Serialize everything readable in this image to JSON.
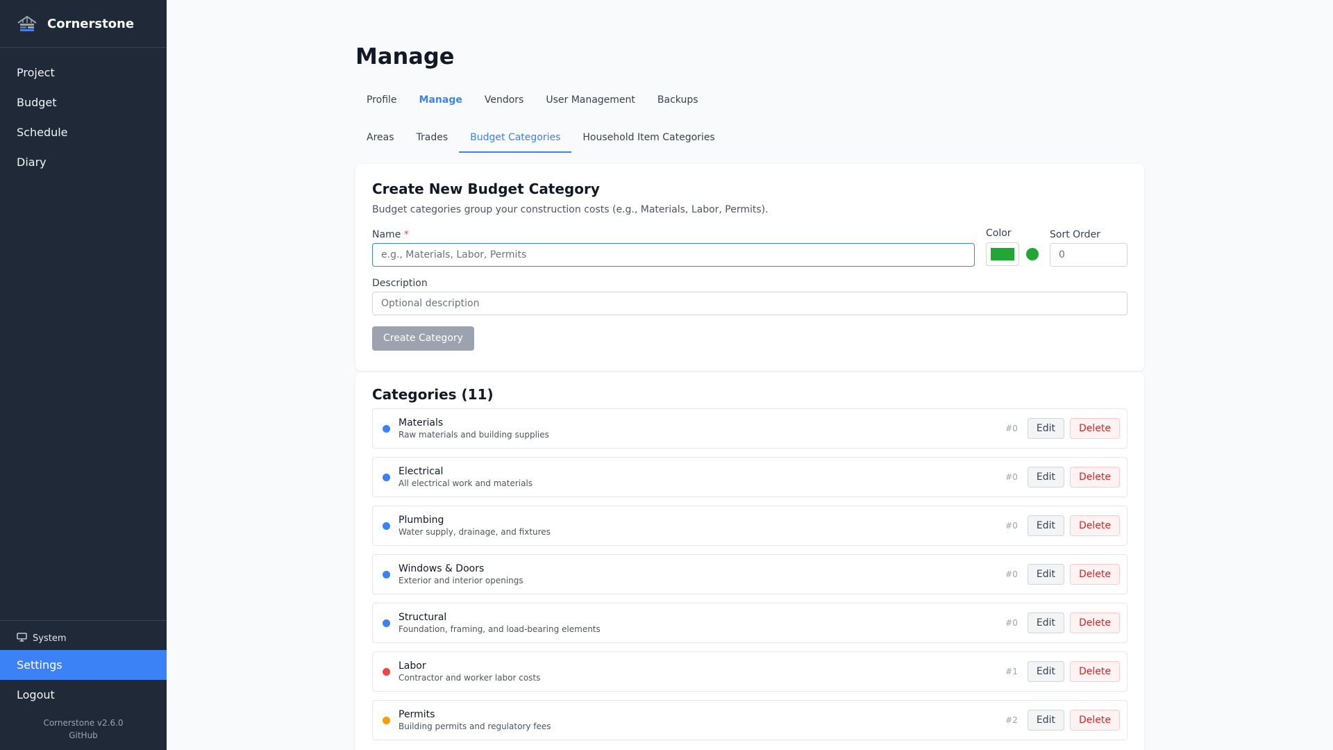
{
  "sidebar": {
    "brand": "Cornerstone",
    "nav": [
      "Project",
      "Budget",
      "Schedule",
      "Diary"
    ],
    "system_label": "System",
    "settings_label": "Settings",
    "logout_label": "Logout",
    "version": "Cornerstone v2.6.0",
    "github": "GitHub"
  },
  "page": {
    "title": "Manage",
    "tabs": [
      "Profile",
      "Manage",
      "Vendors",
      "User Management",
      "Backups"
    ],
    "active_tab": "Manage",
    "subtabs": [
      "Areas",
      "Trades",
      "Budget Categories",
      "Household Item Categories"
    ],
    "active_subtab": "Budget Categories"
  },
  "create_form": {
    "title": "Create New Budget Category",
    "description": "Budget categories group your construction costs (e.g., Materials, Labor, Permits).",
    "name_label": "Name",
    "required_mark": "*",
    "name_placeholder": "e.g., Materials, Labor, Permits",
    "color_label": "Color",
    "color_value": "#22a634",
    "sort_label": "Sort Order",
    "sort_value": "0",
    "desc_label": "Description",
    "desc_placeholder": "Optional description",
    "submit_label": "Create Category"
  },
  "categories": {
    "title": "Categories (11)",
    "edit_label": "Edit",
    "delete_label": "Delete",
    "items": [
      {
        "name": "Materials",
        "description": "Raw materials and building supplies",
        "order": "#0",
        "color": "#3b82f6"
      },
      {
        "name": "Electrical",
        "description": "All electrical work and materials",
        "order": "#0",
        "color": "#3b82f6"
      },
      {
        "name": "Plumbing",
        "description": "Water supply, drainage, and fixtures",
        "order": "#0",
        "color": "#3b82f6"
      },
      {
        "name": "Windows & Doors",
        "description": "Exterior and interior openings",
        "order": "#0",
        "color": "#3b82f6"
      },
      {
        "name": "Structural",
        "description": "Foundation, framing, and load-bearing elements",
        "order": "#0",
        "color": "#3b82f6"
      },
      {
        "name": "Labor",
        "description": "Contractor and worker labor costs",
        "order": "#1",
        "color": "#ef4444"
      },
      {
        "name": "Permits",
        "description": "Building permits and regulatory fees",
        "order": "#2",
        "color": "#f59e0b"
      }
    ]
  }
}
